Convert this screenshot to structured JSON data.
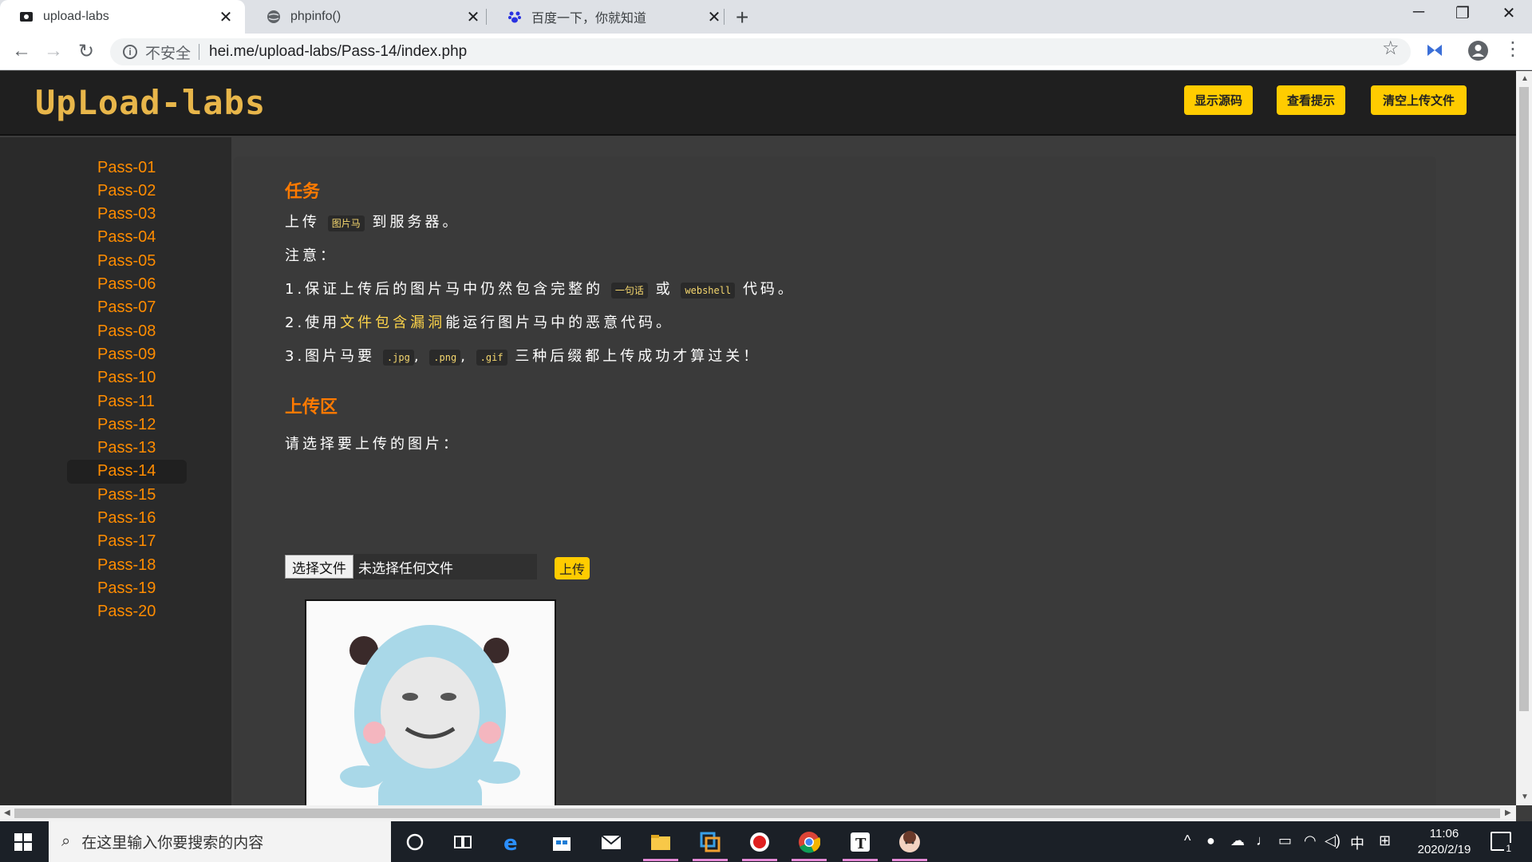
{
  "browser": {
    "tabs": [
      {
        "title": "upload-labs",
        "active": true
      },
      {
        "title": "phpinfo()",
        "active": false
      },
      {
        "title": "百度一下，你就知道",
        "active": false
      }
    ],
    "address": {
      "security": "不安全",
      "url": "hei.me/upload-labs/Pass-14/index.php"
    }
  },
  "site": {
    "logo": "UpLoad-labs",
    "header_buttons": [
      "显示源码",
      "查看提示",
      "清空上传文件"
    ],
    "passes": [
      "Pass-01",
      "Pass-02",
      "Pass-03",
      "Pass-04",
      "Pass-05",
      "Pass-06",
      "Pass-07",
      "Pass-08",
      "Pass-09",
      "Pass-10",
      "Pass-11",
      "Pass-12",
      "Pass-13",
      "Pass-14",
      "Pass-15",
      "Pass-16",
      "Pass-17",
      "Pass-18",
      "Pass-19",
      "Pass-20"
    ],
    "active_pass": "Pass-14"
  },
  "task": {
    "title": "任务",
    "line1_a": "上传",
    "line1_code": "图片马",
    "line1_b": "到服务器。",
    "note": "注意：",
    "line2_a": "1.保证上传后的图片马中仍然包含完整的",
    "line2_code1": "一句话",
    "line2_or": "或",
    "line2_code2": "webshell",
    "line2_b": "代码。",
    "line3_a": "2.使用",
    "line3_hl": "文件包含漏洞",
    "line3_b": "能运行图片马中的恶意代码。",
    "line4_a": "3.图片马要",
    "ext1": ".jpg",
    "comma1": ",",
    "ext2": ".png",
    "comma2": ",",
    "ext3": ".gif",
    "line4_b": "三种后缀都上传成功才算过关！"
  },
  "upload": {
    "title": "上传区",
    "prompt": "请选择要上传的图片：",
    "choose_label": "选择文件",
    "file_status": "未选择任何文件",
    "submit_label": "上传"
  },
  "taskbar": {
    "search_placeholder": "在这里输入你要搜索的内容",
    "ime": "中",
    "time": "11:06",
    "date": "2020/2/19",
    "notifications": "1"
  },
  "colors": {
    "accent_yellow": "#ffcc00",
    "pass_orange": "#ff8c00",
    "title_orange": "#ff7a00"
  }
}
